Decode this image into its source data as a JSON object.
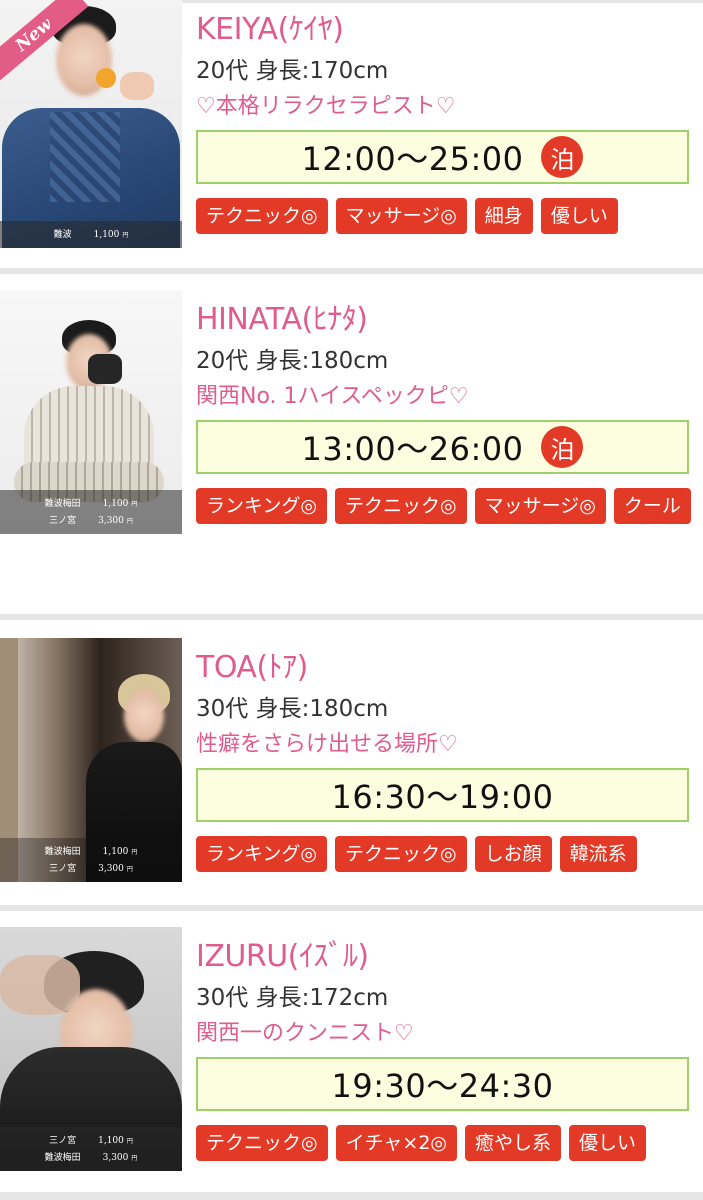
{
  "therapists": [
    {
      "name": "KEIYA(ｹｲﾔ)",
      "stats": "20代 身長:170cm",
      "catchphrase": "♡本格リラクセラピスト♡",
      "time": "12:00〜25:00",
      "overnight": "泊",
      "new_badge": "New",
      "prices": [
        {
          "area": "難波",
          "price": "1,100",
          "unit": "円"
        }
      ],
      "tags": [
        "テクニック◎",
        "マッサージ◎",
        "細身",
        "優しい"
      ]
    },
    {
      "name": "HINATA(ﾋﾅﾀ)",
      "stats": "20代 身長:180cm",
      "catchphrase": "関西No. 1ハイスペックピ♡",
      "time": "13:00〜26:00",
      "overnight": "泊",
      "prices": [
        {
          "area": "難波梅田",
          "price": "1,100",
          "unit": "円"
        },
        {
          "area": "三ノ宮",
          "price": "3,300",
          "unit": "円"
        }
      ],
      "tags": [
        "ランキング◎",
        "テクニック◎",
        "マッサージ◎",
        "クール"
      ]
    },
    {
      "name": "TOA(ﾄｱ)",
      "stats": "30代 身長:180cm",
      "catchphrase": "性癖をさらけ出せる場所♡",
      "time": "16:30〜19:00",
      "prices": [
        {
          "area": "難波梅田",
          "price": "1,100",
          "unit": "円"
        },
        {
          "area": "三ノ宮",
          "price": "3,300",
          "unit": "円"
        }
      ],
      "tags": [
        "ランキング◎",
        "テクニック◎",
        "しお顔",
        "韓流系"
      ]
    },
    {
      "name": "IZURU(ｲｽﾞﾙ)",
      "stats": "30代 身長:172cm",
      "catchphrase": "関西一のクンニスト♡",
      "time": "19:30〜24:30",
      "prices": [
        {
          "area": "三ノ宮",
          "price": "1,100",
          "unit": "円"
        },
        {
          "area": "難波梅田",
          "price": "3,300",
          "unit": "円"
        }
      ],
      "tags": [
        "テクニック◎",
        "イチャ×2◎",
        "癒やし系",
        "優しい"
      ]
    }
  ],
  "colors": {
    "name_pink": "#de5c8e",
    "tag_red": "#e33a27",
    "time_border": "#9fd16b",
    "time_bg": "#fdfde0"
  }
}
